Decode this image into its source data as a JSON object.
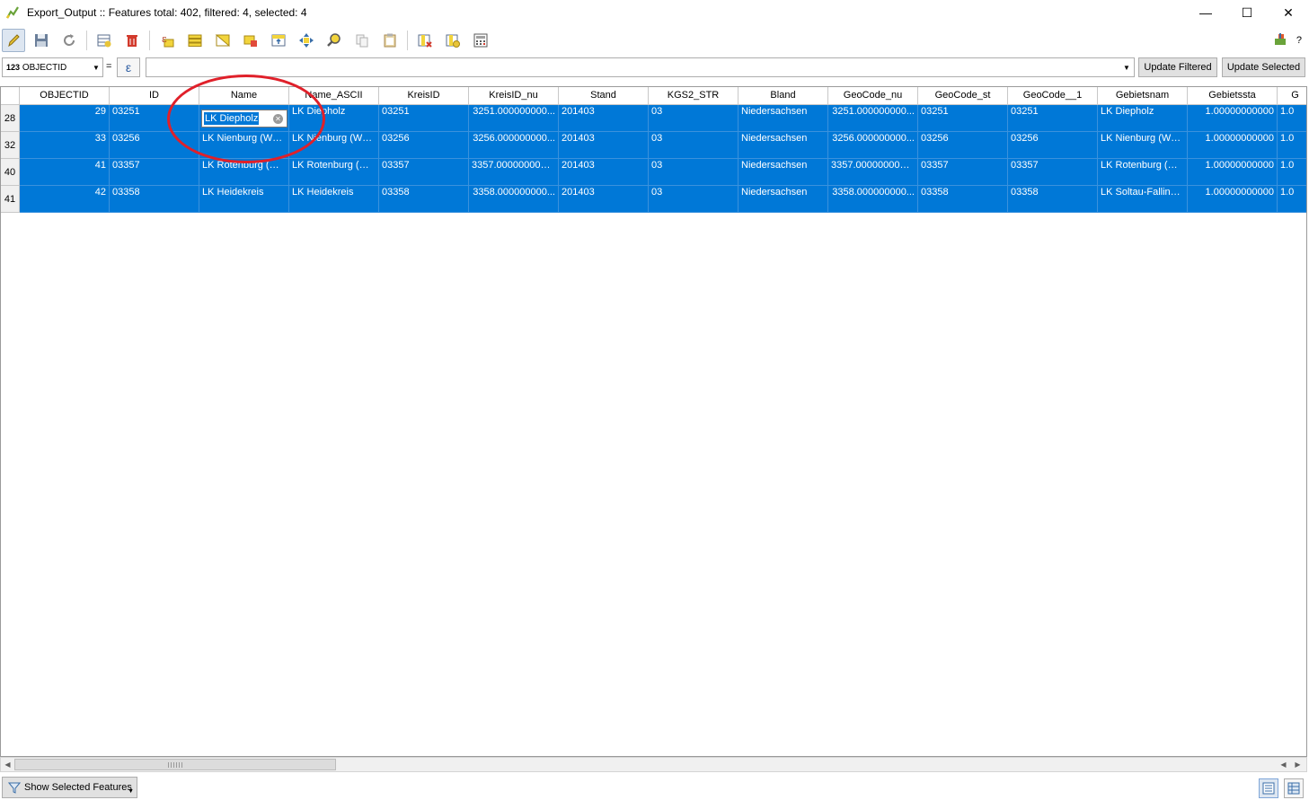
{
  "window": {
    "title": "Export_Output :: Features total: 402, filtered: 4, selected: 4",
    "minimize": "—",
    "maximize": "☐",
    "close": "✕"
  },
  "toolbar": {
    "icons": [
      "pencil-icon",
      "save-icon",
      "reload-icon",
      "add-feature-icon",
      "delete-icon",
      "expression-select-icon",
      "select-all-icon",
      "invert-selection-icon",
      "deselect-icon",
      "move-selection-top-icon",
      "pan-to-selected-icon",
      "zoom-to-selected-icon",
      "copy-icon",
      "paste-icon",
      "delete-field-icon",
      "new-field-icon",
      "field-calculator-icon"
    ],
    "right_icons": [
      "dock-icon",
      "help-icon"
    ],
    "help_label": "?"
  },
  "filter": {
    "field_type": "123",
    "field_name": "OBJECTID",
    "equals": "=",
    "epsilon": "ε",
    "expression_value": "",
    "update_filtered": "Update Filtered",
    "update_selected": "Update Selected"
  },
  "table": {
    "columns": [
      "OBJECTID",
      "ID",
      "Name",
      "Name_ASCII",
      "KreisID",
      "KreisID_nu",
      "Stand",
      "KGS2_STR",
      "Bland",
      "GeoCode_nu",
      "GeoCode_st",
      "GeoCode__1",
      "Gebietsnam",
      "Gebietssta",
      "G"
    ],
    "rows": [
      {
        "row_header": "28",
        "cells": [
          "29",
          "03251",
          "LK Diepholz",
          "LK Diepholz",
          "03251",
          "3251.000000000...",
          "201403",
          "03",
          "Niedersachsen",
          "3251.000000000...",
          "03251",
          "03251",
          "LK Diepholz",
          "1.00000000000",
          "1.0"
        ]
      },
      {
        "row_header": "32",
        "cells": [
          "33",
          "03256",
          "LK Nienburg (We...",
          "LK Nienburg (We...",
          "03256",
          "3256.000000000...",
          "201403",
          "03",
          "Niedersachsen",
          "3256.000000000...",
          "03256",
          "03256",
          "LK Nienburg (We...",
          "1.00000000000",
          "1.0"
        ]
      },
      {
        "row_header": "40",
        "cells": [
          "41",
          "03357",
          "LK Rotenburg (W...",
          "LK Rotenburg (W...",
          "03357",
          "3357.00000000000",
          "201403",
          "03",
          "Niedersachsen",
          "3357.00000000000",
          "03357",
          "03357",
          "LK Rotenburg (W...",
          "1.00000000000",
          "1.0"
        ]
      },
      {
        "row_header": "41",
        "cells": [
          "42",
          "03358",
          "LK Heidekreis",
          "LK Heidekreis",
          "03358",
          "3358.000000000...",
          "201403",
          "03",
          "Niedersachsen",
          "3358.000000000...",
          "03358",
          "03358",
          "LK Soltau-Fallingb...",
          "1.00000000000",
          "1.0"
        ]
      }
    ],
    "editor_value": "LK Diepholz",
    "selection_color": "#0078d7",
    "annotation_color": "#e0202a"
  },
  "scrollbar": {
    "left_arrow": "◀",
    "right_arrow": "▶"
  },
  "bottom": {
    "show_features": "Show Selected Features",
    "caret": "▼",
    "icons": [
      "filter-icon",
      "table-view-icon",
      "form-view-icon"
    ]
  }
}
